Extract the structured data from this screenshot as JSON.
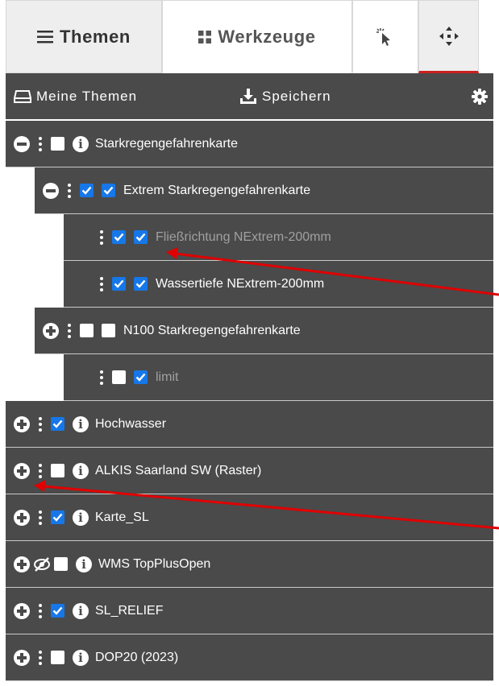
{
  "tabs": [
    {
      "label": "Themen",
      "icon": "menu-icon"
    },
    {
      "label": "Werkzeuge",
      "icon": "grid-icon"
    },
    {
      "label": "",
      "icon": "pointer-click-icon"
    },
    {
      "label": "",
      "icon": "move-arrows-icon"
    }
  ],
  "header": {
    "my_themes": "Meine Themen",
    "save": "Speichern",
    "settings_icon": "gear-icon"
  },
  "tree": [
    {
      "name": "Starkregengefahrenkarte",
      "level": 0,
      "expander": "collapse",
      "visible": false,
      "info": true,
      "dim": false
    },
    {
      "name": "Extrem Starkregengefahrenkarte",
      "level": 1,
      "expander": "collapse",
      "group_checked": true,
      "visible": true,
      "dim": false
    },
    {
      "name": "Fließrichtung NExtrem-200mm",
      "level": 2,
      "visible": true,
      "group_checked": true,
      "dim": true
    },
    {
      "name": "Wassertiefe NExtrem-200mm",
      "level": 2,
      "visible": true,
      "group_checked": true,
      "dim": false
    },
    {
      "name": "N100 Starkregengefahrenkarte",
      "level": 1,
      "expander": "expand",
      "group_checked": false,
      "visible": false,
      "dim": false
    },
    {
      "name": "limit",
      "level": 2,
      "visible": true,
      "group_checked": false,
      "dim": true
    },
    {
      "name": "Hochwasser",
      "level": 0,
      "expander": "expand",
      "visible": true,
      "info": true,
      "dim": false
    },
    {
      "name": "ALKIS Saarland SW (Raster)",
      "level": 0,
      "expander": "expand",
      "visible": false,
      "info": true,
      "dim": false
    },
    {
      "name": "Karte_SL",
      "level": 0,
      "expander": "expand",
      "visible": true,
      "info": true,
      "dim": false
    },
    {
      "name": "WMS TopPlusOpen",
      "level": 0,
      "expander": "expand",
      "visible": false,
      "info": true,
      "dim": false,
      "hidden_icon": true
    },
    {
      "name": "SL_RELIEF",
      "level": 0,
      "expander": "expand",
      "visible": true,
      "info": true,
      "dim": false
    },
    {
      "name": "DOP20 (2023)",
      "level": 0,
      "expander": "expand",
      "visible": false,
      "info": true,
      "dim": false
    }
  ],
  "colors": {
    "panel_bg": "#4a4a4a",
    "checkbox_on": "#1677e8",
    "accent_red": "#cc1f1f",
    "annotation_arrow": "#e00000"
  }
}
